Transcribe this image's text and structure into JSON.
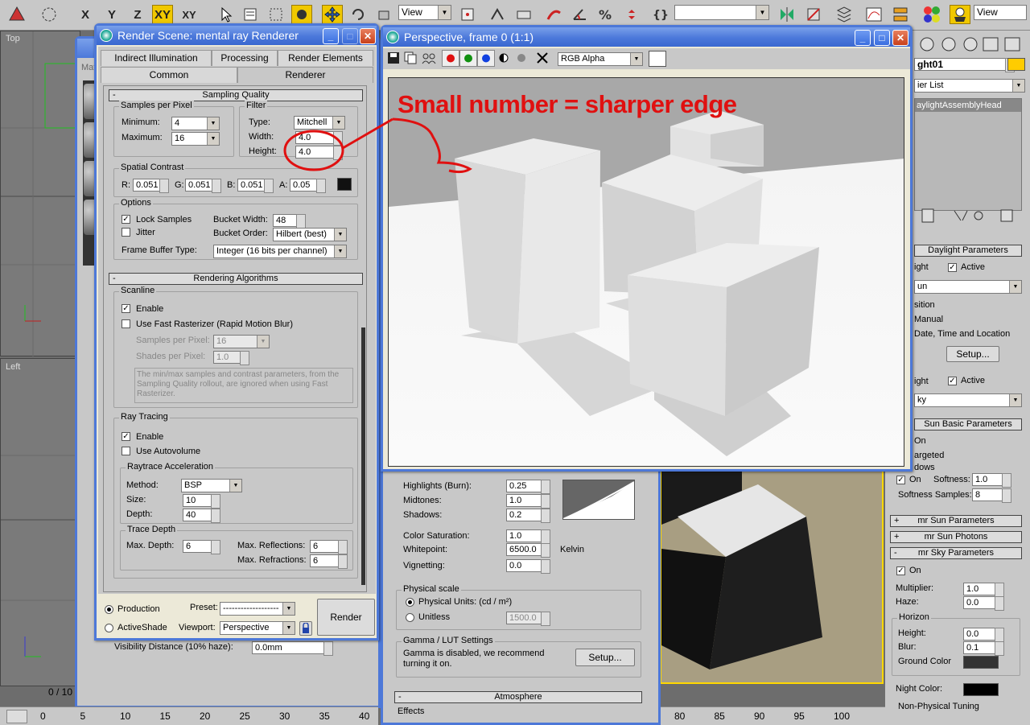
{
  "toolbar": {
    "axis_x": "X",
    "axis_y": "Y",
    "axis_z": "Z",
    "axis_xy": "XY",
    "axis_xy2": "XY",
    "view_select": "View",
    "view_select_right": "View",
    "selection_set": ""
  },
  "viewports": {
    "top_label": "Top",
    "left_label": "Left",
    "mat_label": "Mat"
  },
  "timeline": {
    "frame": "0 / 10",
    "ticks_left": [
      "0",
      "5",
      "10",
      "15",
      "20",
      "25",
      "30",
      "35",
      "40"
    ],
    "ticks_right": [
      "80",
      "85",
      "90",
      "95",
      "100"
    ]
  },
  "render_scene": {
    "title": "Render Scene: mental ray Renderer",
    "tabs_row1": [
      "Indirect Illumination",
      "Processing",
      "Render Elements"
    ],
    "tabs_row2": [
      "Common",
      "Renderer"
    ],
    "sampling_quality": {
      "header": "Sampling Quality",
      "samples_group": "Samples per Pixel",
      "minimum_label": "Minimum:",
      "minimum_value": "4",
      "maximum_label": "Maximum:",
      "maximum_value": "16",
      "filter_group": "Filter",
      "type_label": "Type:",
      "type_value": "Mitchell",
      "width_label": "Width:",
      "width_value": "4.0",
      "height_label": "Height:",
      "height_value": "4.0",
      "spatial_group": "Spatial Contrast",
      "r_label": "R:",
      "r_value": "0.051",
      "g_label": "G:",
      "g_value": "0.051",
      "b_label": "B:",
      "b_value": "0.051",
      "a_label": "A:",
      "a_value": "0.05",
      "options_group": "Options",
      "lock_samples": "Lock Samples",
      "jitter": "Jitter",
      "bucket_width_label": "Bucket Width:",
      "bucket_width_value": "48",
      "bucket_order_label": "Bucket Order:",
      "bucket_order_value": "Hilbert (best)",
      "frame_buffer_label": "Frame Buffer Type:",
      "frame_buffer_value": "Integer (16 bits per channel)"
    },
    "rendering_algorithms": {
      "header": "Rendering Algorithms",
      "scanline_group": "Scanline",
      "enable": "Enable",
      "fast_rasterizer": "Use Fast Rasterizer (Rapid Motion Blur)",
      "samples_per_pixel_label": "Samples per Pixel:",
      "samples_per_pixel_value": "16",
      "shades_per_pixel_label": "Shades per Pixel:",
      "shades_per_pixel_value": "1.0",
      "note": "The min/max samples and contrast parameters, from the Sampling Quality rollout, are ignored when using Fast Rasterizer.",
      "ray_tracing_group": "Ray Tracing",
      "rt_enable": "Enable",
      "use_autovolume": "Use Autovolume",
      "accel_group": "Raytrace Acceleration",
      "method_label": "Method:",
      "method_value": "BSP",
      "size_label": "Size:",
      "size_value": "10",
      "depth_label": "Depth:",
      "depth_value": "40",
      "trace_depth_group": "Trace Depth",
      "max_depth_label": "Max. Depth:",
      "max_depth_value": "6",
      "max_reflections_label": "Max. Reflections:",
      "max_reflections_value": "6",
      "max_refractions_label": "Max. Refractions:",
      "max_refractions_value": "6"
    },
    "footer": {
      "production": "Production",
      "activeshade": "ActiveShade",
      "preset_label": "Preset:",
      "preset_value": "-------------------",
      "viewport_label": "Viewport:",
      "viewport_value": "Perspective",
      "render_button": "Render"
    },
    "behind_text": "Visibility Distance (10% haze):",
    "behind_value": "0.0mm"
  },
  "frame_window": {
    "title": "Perspective, frame 0 (1:1)",
    "channel_value": "RGB Alpha",
    "annotation": "Small number = sharper edge"
  },
  "exposure_panel": {
    "highlights_label": "Highlights (Burn):",
    "highlights_value": "0.25",
    "midtones_label": "Midtones:",
    "midtones_value": "1.0",
    "shadows_label": "Shadows:",
    "shadows_value": "0.2",
    "color_saturation_label": "Color Saturation:",
    "color_saturation_value": "1.0",
    "whitepoint_label": "Whitepoint:",
    "whitepoint_value": "6500.0",
    "kelvin": "Kelvin",
    "vignetting_label": "Vignetting:",
    "vignetting_value": "0.0",
    "physical_scale_group": "Physical scale",
    "physical_units": "Physical Units: (cd / m²)",
    "unitless": "Unitless",
    "unitless_value": "1500.0",
    "gamma_group": "Gamma / LUT Settings",
    "gamma_note": "Gamma is disabled, we recommend turning it on.",
    "setup_button": "Setup...",
    "atmosphere_header": "Atmosphere",
    "effects_label": "Effects"
  },
  "command_panel": {
    "object_name": "ght01",
    "modifier_list": "ier List",
    "stack_item": "aylightAssemblyHead",
    "daylight_header": "Daylight Parameters",
    "sunlight_label": "ight",
    "active1": "Active",
    "sun_type": "un",
    "position_label": "sition",
    "manual": "Manual",
    "date_time": "Date, Time and Location",
    "setup_button": "Setup...",
    "skylight_label": "ight",
    "active2": "Active",
    "sky_type": "ky",
    "sun_basic_header": "Sun Basic Parameters",
    "on_label": "On",
    "targeted": "argeted",
    "shadows_group": "dows",
    "shadows_on": "On",
    "softness_label": "Softness:",
    "softness_value": "1.0",
    "soft_samples_label": "Softness Samples:",
    "soft_samples_value": "8",
    "mr_sun_params": "mr Sun Parameters",
    "mr_sun_photons": "mr Sun Photons",
    "mr_sky_params": "mr Sky Parameters",
    "sky_on": "On",
    "multiplier_label": "Multiplier:",
    "multiplier_value": "1.0",
    "haze_label": "Haze:",
    "haze_value": "0.0",
    "horizon_group": "Horizon",
    "height_label": "Height:",
    "height_value": "0.0",
    "blur_label": "Blur:",
    "blur_value": "0.1",
    "ground_color_label": "Ground Color",
    "night_color_label": "Night Color:",
    "non_physical": "Non-Physical Tuning",
    "plus": "+",
    "minus": "-"
  },
  "colors": {
    "title_blue": "#4b78da",
    "annotation_red": "#e01010",
    "ground_color": "#333333",
    "night_color": "#000000",
    "viewport_yellow": "#ffd800"
  }
}
